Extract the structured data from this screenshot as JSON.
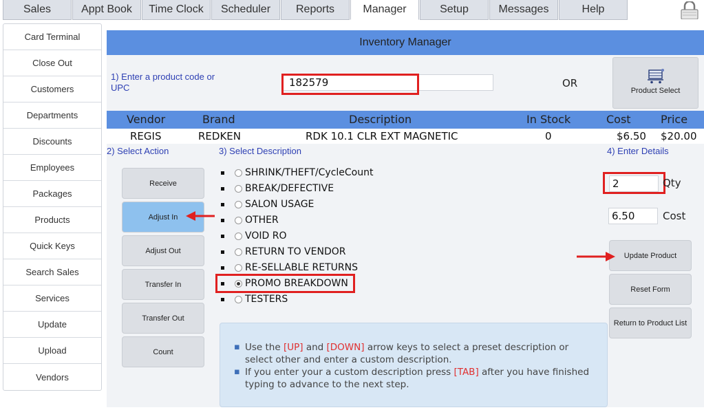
{
  "nav": {
    "tabs": [
      {
        "label": "Sales"
      },
      {
        "label": "Appt Book"
      },
      {
        "label": "Time Clock"
      },
      {
        "label": "Scheduler"
      },
      {
        "label": "Reports"
      },
      {
        "label": "Manager",
        "active": true
      },
      {
        "label": "Setup"
      },
      {
        "label": "Messages"
      },
      {
        "label": "Help"
      }
    ]
  },
  "sidebar": {
    "items": [
      {
        "label": "Card Terminal"
      },
      {
        "label": "Close Out"
      },
      {
        "label": "Customers"
      },
      {
        "label": "Departments"
      },
      {
        "label": "Discounts"
      },
      {
        "label": "Employees"
      },
      {
        "label": "Packages"
      },
      {
        "label": "Products"
      },
      {
        "label": "Quick Keys"
      },
      {
        "label": "Search Sales"
      },
      {
        "label": "Services"
      },
      {
        "label": "Update"
      },
      {
        "label": "Upload"
      },
      {
        "label": "Vendors"
      }
    ]
  },
  "main": {
    "title": "Inventory Manager",
    "step1_label": "1) Enter a product code or UPC",
    "product_code_value": "182579",
    "or_text": "OR",
    "product_select_label": "Product Select",
    "table": {
      "headers": [
        "Vendor",
        "Brand",
        "Description",
        "In Stock",
        "Cost",
        "Price"
      ],
      "row": [
        "REGIS",
        "REDKEN",
        "RDK 10.1 CLR EXT MAGNETIC",
        "0",
        "$6.50",
        "$20.00"
      ]
    },
    "step2_label": "2) Select Action",
    "step3_label": "3) Select Description",
    "step4_label": "4) Enter Details",
    "actions": [
      {
        "label": "Receive"
      },
      {
        "label": "Adjust In",
        "selected": true
      },
      {
        "label": "Adjust Out"
      },
      {
        "label": "Transfer In"
      },
      {
        "label": "Transfer Out"
      },
      {
        "label": "Count"
      }
    ],
    "descriptions": [
      {
        "label": "SHRINK/THEFT/CycleCount"
      },
      {
        "label": "BREAK/DEFECTIVE"
      },
      {
        "label": "SALON USAGE"
      },
      {
        "label": "OTHER"
      },
      {
        "label": "VOID RO"
      },
      {
        "label": "RETURN TO VENDOR"
      },
      {
        "label": "RE-SELLABLE RETURNS"
      },
      {
        "label": "PROMO BREAKDOWN",
        "checked": true
      },
      {
        "label": "TESTERS"
      }
    ],
    "qty_value": "2",
    "qty_label": "Qty",
    "cost_value": "6.50",
    "cost_label": "Cost",
    "detail_buttons": [
      {
        "label": "Update Product"
      },
      {
        "label": "Reset Form"
      },
      {
        "label": "Return to Product List"
      }
    ],
    "help": {
      "line1_a": "Use the ",
      "line1_key1": "[UP]",
      "line1_b": " and ",
      "line1_key2": "[DOWN]",
      "line1_c": " arrow keys to select a preset description or select other and enter a custom description.",
      "line2_a": "If you enter your a custom description press ",
      "line2_key": "[TAB]",
      "line2_b": " after you have finished typing to advance to the next step."
    }
  },
  "colors": {
    "header_blue": "#5b8fe0",
    "selected_button": "#8ec1ee",
    "highlight_red": "#e02020",
    "label_blue": "#2d3fb3"
  }
}
